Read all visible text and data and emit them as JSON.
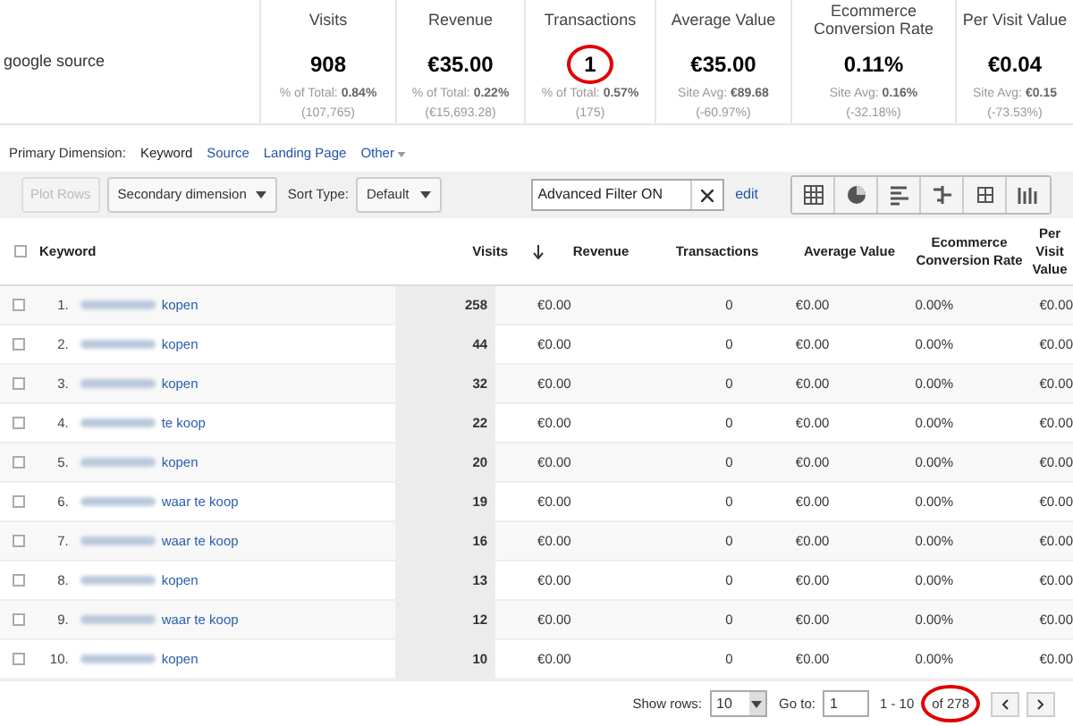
{
  "summary": {
    "label": "google source",
    "metrics": [
      {
        "title": "Visits",
        "value": "908",
        "line1_label": "% of Total:",
        "line1_value": "0.84%",
        "line2": "(107,765)",
        "circled": false
      },
      {
        "title": "Revenue",
        "value": "€35.00",
        "line1_label": "% of Total:",
        "line1_value": "0.22%",
        "line2": "(€15,693.28)",
        "circled": false
      },
      {
        "title": "Transactions",
        "value": "1",
        "line1_label": "% of Total:",
        "line1_value": "0.57%",
        "line2": "(175)",
        "circled": true
      },
      {
        "title": "Average Value",
        "value": "€35.00",
        "line1_label": "Site Avg:",
        "line1_value": "€89.68",
        "line2": "(-60.97%)",
        "circled": false
      },
      {
        "title": "Ecommerce Conversion Rate",
        "value": "0.11%",
        "line1_label": "Site Avg:",
        "line1_value": "0.16%",
        "line2": "(-32.18%)",
        "circled": false
      },
      {
        "title": "Per Visit Value",
        "value": "€0.04",
        "line1_label": "Site Avg:",
        "line1_value": "€0.15",
        "line2": "(-73.53%)",
        "circled": false
      }
    ]
  },
  "dimensions": {
    "label": "Primary Dimension:",
    "items": [
      {
        "label": "Keyword",
        "selected": true
      },
      {
        "label": "Source",
        "selected": false
      },
      {
        "label": "Landing Page",
        "selected": false
      },
      {
        "label": "Other",
        "selected": false
      }
    ]
  },
  "toolbar": {
    "plot_rows": "Plot Rows",
    "secondary": "Secondary dimension",
    "sort_label": "Sort Type:",
    "sort_value": "Default",
    "filter": "Advanced Filter ON",
    "edit": "edit"
  },
  "table": {
    "select_all_checked": false,
    "columns": [
      "Keyword",
      "Visits",
      "Revenue",
      "Transactions",
      "Average Value",
      "Ecommerce Conversion Rate",
      "Per Visit Value"
    ],
    "rows": [
      {
        "checked": false,
        "number": "1.",
        "cells": [
          "kopen",
          "258",
          "€0.00",
          "0",
          "€0.00",
          "0.00%",
          "€0.00"
        ]
      },
      {
        "checked": false,
        "number": "2.",
        "cells": [
          "kopen",
          "44",
          "€0.00",
          "0",
          "€0.00",
          "0.00%",
          "€0.00"
        ]
      },
      {
        "checked": false,
        "number": "3.",
        "cells": [
          "kopen",
          "32",
          "€0.00",
          "0",
          "€0.00",
          "0.00%",
          "€0.00"
        ]
      },
      {
        "checked": false,
        "number": "4.",
        "cells": [
          "te koop",
          "22",
          "€0.00",
          "0",
          "€0.00",
          "0.00%",
          "€0.00"
        ]
      },
      {
        "checked": false,
        "number": "5.",
        "cells": [
          "kopen",
          "20",
          "€0.00",
          "0",
          "€0.00",
          "0.00%",
          "€0.00"
        ]
      },
      {
        "checked": false,
        "number": "6.",
        "cells": [
          "waar te koop",
          "19",
          "€0.00",
          "0",
          "€0.00",
          "0.00%",
          "€0.00"
        ]
      },
      {
        "checked": false,
        "number": "7.",
        "cells": [
          "waar te koop",
          "16",
          "€0.00",
          "0",
          "€0.00",
          "0.00%",
          "€0.00"
        ]
      },
      {
        "checked": false,
        "number": "8.",
        "cells": [
          "kopen",
          "13",
          "€0.00",
          "0",
          "€0.00",
          "0.00%",
          "€0.00"
        ]
      },
      {
        "checked": false,
        "number": "9.",
        "cells": [
          "waar te koop",
          "12",
          "€0.00",
          "0",
          "€0.00",
          "0.00%",
          "€0.00"
        ]
      },
      {
        "checked": false,
        "number": "10.",
        "cells": [
          "kopen",
          "10",
          "€0.00",
          "0",
          "€0.00",
          "0.00%",
          "€0.00"
        ]
      }
    ]
  },
  "pagination": {
    "show_rows_label": "Show rows:",
    "show_rows": "10",
    "goto_label": "Go to:",
    "goto": "1",
    "range": "1 - 10",
    "total": "of 278",
    "total_circled": true
  }
}
